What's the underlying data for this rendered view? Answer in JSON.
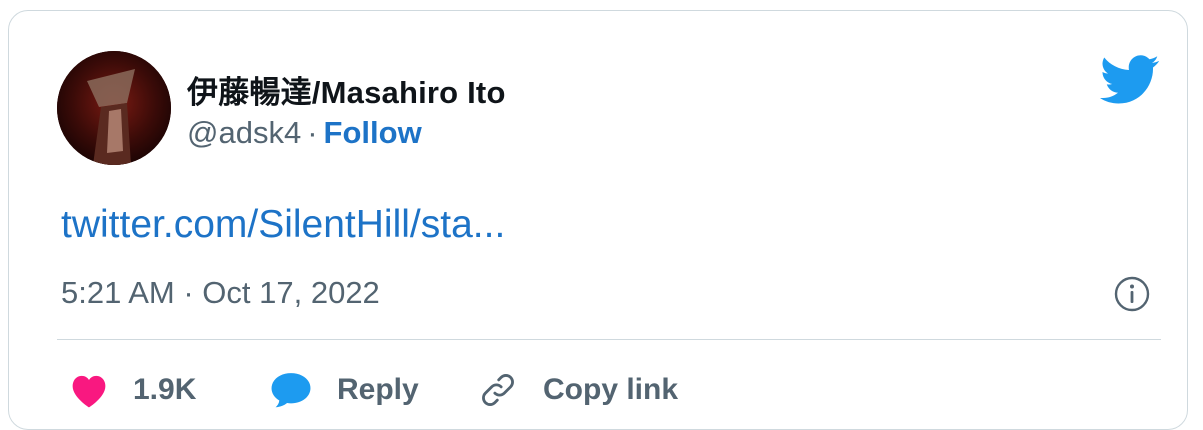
{
  "tweet": {
    "author": {
      "display_name": "伊藤暢達/Masahiro Ito",
      "handle": "@adsk4",
      "separator": "·",
      "follow_label": "Follow"
    },
    "link_text": "twitter.com/SilentHill/sta...",
    "timestamp": "5:21 AM · Oct 17, 2022",
    "actions": {
      "like_count": "1.9K",
      "reply_label": "Reply",
      "copy_link_label": "Copy link"
    }
  },
  "icons": {
    "brand": "twitter-bird-icon",
    "info": "info-icon",
    "like": "heart-icon",
    "reply": "speech-bubble-icon",
    "copy": "chain-link-icon"
  },
  "colors": {
    "link_blue": "#1d73c7",
    "twitter_blue": "#1d9bf0",
    "like_pink": "#f91880",
    "muted_text": "#536471",
    "border": "#cfd9de"
  }
}
